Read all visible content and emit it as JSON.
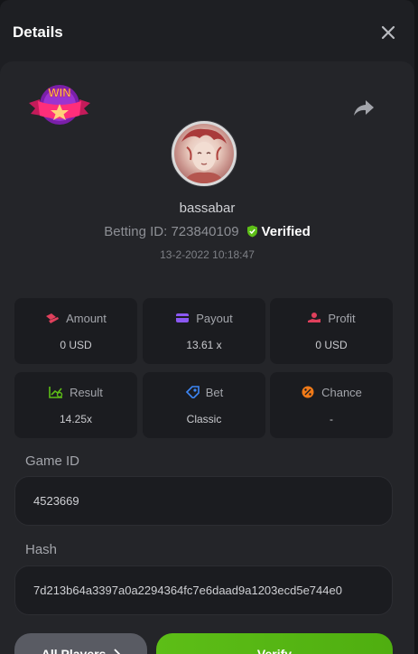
{
  "header": {
    "title": "Details"
  },
  "badge": {
    "text": "WIN"
  },
  "player": {
    "username": "bassabar",
    "betting_id_label": "Betting ID: 723840109",
    "verified_label": "Verified",
    "date": "13-2-2022 10:18:47"
  },
  "stats": [
    {
      "label": "Amount",
      "value": "0 USD",
      "icon": "amount-icon",
      "color": "#e0405c"
    },
    {
      "label": "Payout",
      "value": "13.61 x",
      "icon": "payout-icon",
      "color": "#8b58f2"
    },
    {
      "label": "Profit",
      "value": "0 USD",
      "icon": "profit-icon",
      "color": "#e0405c"
    },
    {
      "label": "Result",
      "value": "14.25x",
      "icon": "result-icon",
      "color": "#5dbe17"
    },
    {
      "label": "Bet",
      "value": "Classic",
      "icon": "bet-icon",
      "color": "#3d86f5"
    },
    {
      "label": "Chance",
      "value": "-",
      "icon": "chance-icon",
      "color": "#f07a18"
    }
  ],
  "game_id": {
    "label": "Game ID",
    "value": "4523669"
  },
  "hash": {
    "label": "Hash",
    "value": "7d213b64a3397a0a2294364fc7e6daad9a1203ecd5e744e0"
  },
  "buttons": {
    "all_players": "All Players",
    "verify": "Verify"
  },
  "colors": {
    "accent_green": "#5dbe17",
    "card_bg": "#242529",
    "tile_bg": "#1b1c20"
  }
}
